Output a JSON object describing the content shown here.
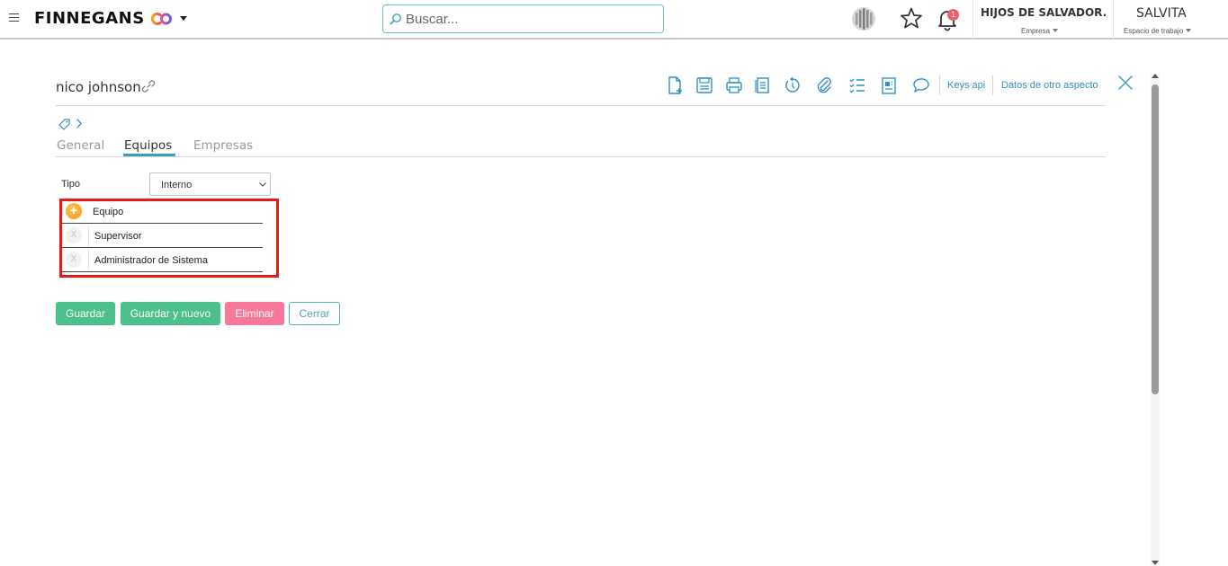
{
  "header": {
    "logo_text": "FINNEGANS",
    "search_placeholder": "Buscar...",
    "notification_count": "1",
    "company": {
      "name": "HIJOS DE SALVADOR...",
      "label": "Empresa"
    },
    "workspace": {
      "name": "SALVITA",
      "label": "Espacio de trabajo"
    },
    "icons": [
      "menu-icon",
      "logo-co-icon",
      "mic-icon",
      "star-icon",
      "bell-icon"
    ]
  },
  "record": {
    "title": "nico johnson"
  },
  "toolbar": {
    "icons": [
      "new-document-icon",
      "save-icon",
      "print-icon",
      "copy-icon",
      "history-icon",
      "attachment-icon",
      "checklist-icon",
      "report-icon",
      "comment-icon"
    ],
    "keys_api_label": "Keys api",
    "other_aspect_label": "Datos de otro aspecto"
  },
  "tabs": [
    {
      "label": "General",
      "active": false
    },
    {
      "label": "Equipos",
      "active": true
    },
    {
      "label": "Empresas",
      "active": false
    }
  ],
  "form": {
    "tipo_label": "Tipo",
    "tipo_value": "Interno",
    "teams": [
      {
        "label": "Equipo",
        "action": "add"
      },
      {
        "label": "Supervisor",
        "action": "remove",
        "remove_glyph": "X"
      },
      {
        "label": "Administrador de Sistema",
        "action": "remove",
        "remove_glyph": "X"
      }
    ]
  },
  "buttons": {
    "save": "Guardar",
    "save_new": "Guardar y nuevo",
    "delete": "Eliminar",
    "close": "Cerrar"
  },
  "colors": {
    "accent": "#2fa3c4",
    "green": "#4cc08b",
    "pink": "#f7789b",
    "highlight": "#e61a1a",
    "add_button": "#f39a12",
    "badge": "#f35d68"
  }
}
